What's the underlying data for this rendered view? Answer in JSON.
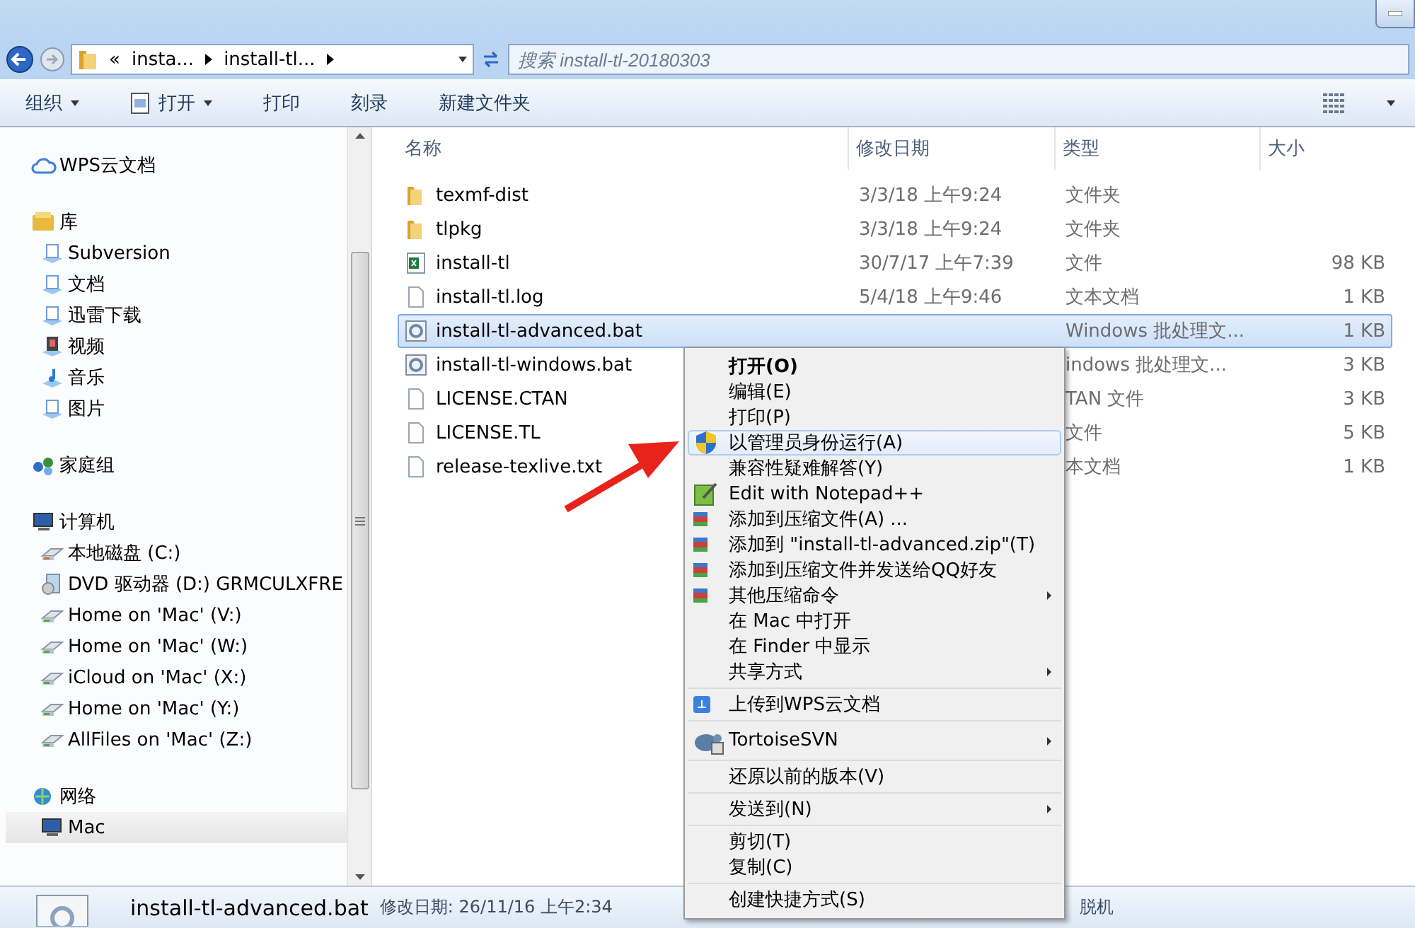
{
  "address_bar": {
    "overflow": "«",
    "crumbs": [
      "insta...",
      "install-tl..."
    ],
    "search_placeholder": "搜索 install-tl-20180303"
  },
  "toolbar": {
    "buttons": [
      {
        "label": "组织",
        "dropdown": true,
        "icon": false
      },
      {
        "label": "打开",
        "dropdown": true,
        "icon": true
      },
      {
        "label": "打印",
        "dropdown": false,
        "icon": false
      },
      {
        "label": "刻录",
        "dropdown": false,
        "icon": false
      },
      {
        "label": "新建文件夹",
        "dropdown": false,
        "icon": false
      }
    ]
  },
  "sidebar": {
    "sections": [
      {
        "label": "WPS云文档",
        "kind": "cloud"
      },
      {
        "label": "库",
        "kind": "library",
        "children": [
          {
            "label": "Subversion",
            "kind": "lib",
            "selected": false
          },
          {
            "label": "文档",
            "kind": "lib",
            "selected": false
          },
          {
            "label": "迅雷下载",
            "kind": "lib",
            "selected": false
          },
          {
            "label": "视频",
            "kind": "video",
            "selected": false
          },
          {
            "label": "音乐",
            "kind": "music",
            "selected": false
          },
          {
            "label": "图片",
            "kind": "lib",
            "selected": false
          }
        ]
      },
      {
        "label": "家庭组",
        "kind": "homegroup"
      },
      {
        "label": "计算机",
        "kind": "computer",
        "children": [
          {
            "label": "本地磁盘 (C:)",
            "kind": "disk",
            "selected": false
          },
          {
            "label": "DVD 驱动器 (D:) GRMCULXFRE",
            "kind": "dvd",
            "selected": false
          },
          {
            "label": "Home on 'Mac' (V:)",
            "kind": "netdrive",
            "selected": false
          },
          {
            "label": "Home on 'Mac' (W:)",
            "kind": "netdrive",
            "selected": false
          },
          {
            "label": "iCloud on 'Mac' (X:)",
            "kind": "netdrive",
            "selected": false
          },
          {
            "label": "Home on 'Mac' (Y:)",
            "kind": "netdrive",
            "selected": false
          },
          {
            "label": "AllFiles on 'Mac' (Z:)",
            "kind": "netdrive",
            "selected": false
          }
        ]
      },
      {
        "label": "网络",
        "kind": "network",
        "children": [
          {
            "label": "Mac",
            "kind": "computer",
            "selected": true
          }
        ]
      }
    ]
  },
  "columns": [
    "名称",
    "修改日期",
    "类型",
    "大小"
  ],
  "files": [
    {
      "name": "texmf-dist",
      "date": "3/3/18 上午9:24",
      "type": "文件夹",
      "kind": "folder",
      "selected": false
    },
    {
      "name": "tlpkg",
      "date": "3/3/18 上午9:24",
      "type": "文件夹",
      "kind": "folder",
      "selected": false
    },
    {
      "name": "install-tl",
      "date": "30/7/17 上午7:39",
      "type": "文件",
      "size": "98 KB",
      "kind": "sheet",
      "selected": false
    },
    {
      "name": "install-tl.log",
      "date": "5/4/18 上午9:46",
      "type": "文本文档",
      "size": "1 KB",
      "kind": "text",
      "selected": false
    },
    {
      "name": "install-tl-advanced.bat",
      "type": "Windows 批处理文...",
      "size": "1 KB",
      "kind": "batch",
      "selected": true
    },
    {
      "name": "install-tl-windows.bat",
      "type": "indows 批处理文...",
      "size": "3 KB",
      "kind": "batch",
      "selected": false
    },
    {
      "name": "LICENSE.CTAN",
      "type": "TAN 文件",
      "size": "3 KB",
      "kind": "text",
      "selected": false
    },
    {
      "name": "LICENSE.TL",
      "type": "文件",
      "size": "5 KB",
      "kind": "text",
      "selected": false
    },
    {
      "name": "release-texlive.txt",
      "type": "本文档",
      "size": "1 KB",
      "kind": "text",
      "selected": false
    }
  ],
  "context_menu": {
    "groups": [
      [
        {
          "label": "打开(O)",
          "kind": "plain",
          "bold": true,
          "submenu": false,
          "selected": false
        },
        {
          "label": "编辑(E)",
          "kind": "plain",
          "bold": false,
          "submenu": false,
          "selected": false
        },
        {
          "label": "打印(P)",
          "kind": "plain",
          "bold": false,
          "submenu": false,
          "selected": false
        },
        {
          "label": "以管理员身份运行(A)",
          "kind": "shield",
          "bold": false,
          "submenu": false,
          "selected": true
        },
        {
          "label": "兼容性疑难解答(Y)",
          "kind": "plain",
          "bold": false,
          "submenu": false,
          "selected": false
        },
        {
          "label": "Edit with Notepad++",
          "kind": "notepad",
          "bold": false,
          "submenu": false,
          "selected": false
        },
        {
          "label": "添加到压缩文件(A) ...",
          "kind": "archive",
          "bold": false,
          "submenu": false,
          "selected": false
        },
        {
          "label": "添加到 \"install-tl-advanced.zip\"(T)",
          "kind": "archive",
          "bold": false,
          "submenu": false,
          "selected": false
        },
        {
          "label": "添加到压缩文件并发送给QQ好友",
          "kind": "archive",
          "bold": false,
          "submenu": false,
          "selected": false
        },
        {
          "label": "其他压缩命令",
          "kind": "archive",
          "bold": false,
          "submenu": true,
          "selected": false
        },
        {
          "label": "在 Mac 中打开",
          "kind": "plain",
          "bold": false,
          "submenu": false,
          "selected": false
        },
        {
          "label": "在 Finder 中显示",
          "kind": "plain",
          "bold": false,
          "submenu": false,
          "selected": false
        },
        {
          "label": "共享方式",
          "kind": "plain",
          "bold": false,
          "submenu": true,
          "selected": false
        }
      ],
      [
        {
          "label": "上传到WPS云文档",
          "kind": "cloud",
          "bold": false,
          "submenu": false,
          "selected": false
        }
      ],
      [
        {
          "label": "TortoiseSVN",
          "kind": "turtle",
          "bold": false,
          "submenu": true,
          "selected": false
        }
      ],
      [
        {
          "label": "还原以前的版本(V)",
          "kind": "plain",
          "bold": false,
          "submenu": false,
          "selected": false
        }
      ],
      [
        {
          "label": "发送到(N)",
          "kind": "plain",
          "bold": false,
          "submenu": true,
          "selected": false
        }
      ],
      [
        {
          "label": "剪切(T)",
          "kind": "plain",
          "bold": false,
          "submenu": false,
          "selected": false
        },
        {
          "label": "复制(C)",
          "kind": "plain",
          "bold": false,
          "submenu": false,
          "selected": false
        }
      ],
      [
        {
          "label": "创建快捷方式(S)",
          "kind": "plain",
          "bold": false,
          "submenu": false,
          "selected": false
        }
      ]
    ]
  },
  "status_bar": {
    "name": "install-tl-advanced.bat",
    "detail": "修改日期: 26/11/16 上午2:34",
    "state": "脱机"
  }
}
